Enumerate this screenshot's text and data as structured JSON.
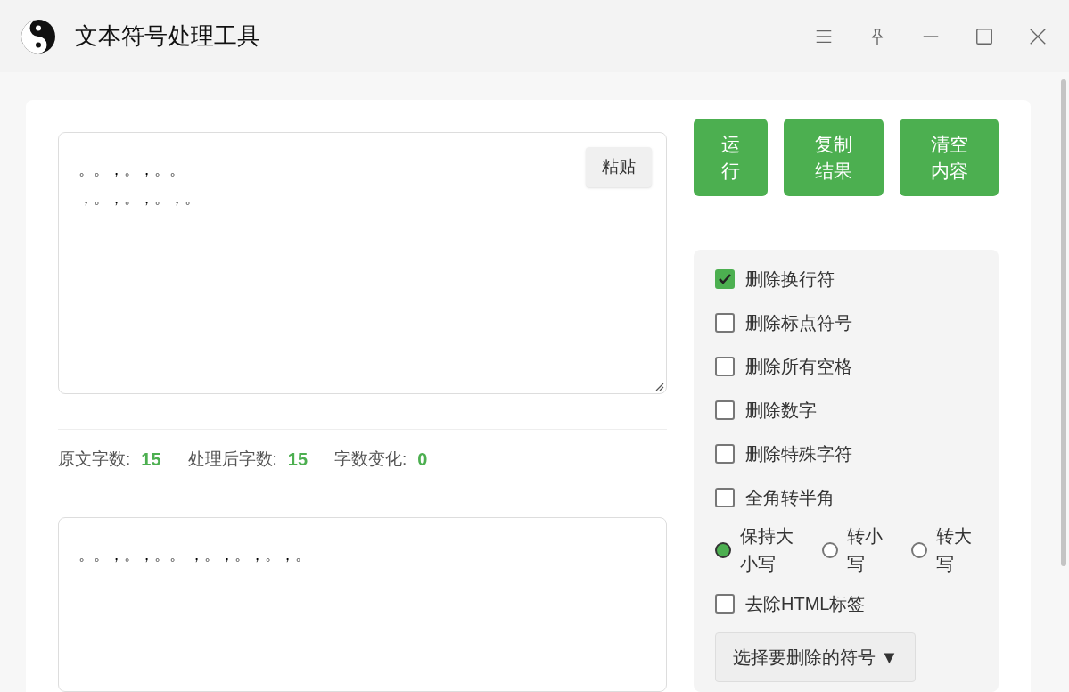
{
  "window": {
    "title": "文本符号处理工具"
  },
  "input": {
    "lines": [
      "。。，。，。。",
      "，。，。，。，。"
    ],
    "paste_button": "粘贴"
  },
  "stats": [
    {
      "label": "原文字数:",
      "value": "15"
    },
    {
      "label": "处理后字数:",
      "value": "15"
    },
    {
      "label": "字数变化:",
      "value": "0"
    }
  ],
  "output": {
    "value": "。。，。，。。 ，。，。，。，。"
  },
  "buttons": [
    {
      "label": "运行"
    },
    {
      "label": "复制结果"
    },
    {
      "label": "清空内容"
    }
  ],
  "options": [
    {
      "kind": "checkbox",
      "label": "删除换行符",
      "checked": true
    },
    {
      "kind": "checkbox",
      "label": "删除标点符号",
      "checked": false
    },
    {
      "kind": "checkbox",
      "label": "删除所有空格",
      "checked": false
    },
    {
      "kind": "checkbox",
      "label": "删除数字",
      "checked": false
    },
    {
      "kind": "checkbox",
      "label": "删除特殊字符",
      "checked": false
    },
    {
      "kind": "checkbox",
      "label": "全角转半角",
      "checked": false
    },
    {
      "kind": "radio-group",
      "choices": [
        {
          "label": "保持大小写",
          "selected": true
        },
        {
          "label": "转小写",
          "selected": false
        },
        {
          "label": "转大写",
          "selected": false
        }
      ]
    },
    {
      "kind": "checkbox",
      "label": "去除HTML标签",
      "checked": false
    },
    {
      "kind": "dropdown",
      "label": "选择要删除的符号 ▼"
    }
  ]
}
